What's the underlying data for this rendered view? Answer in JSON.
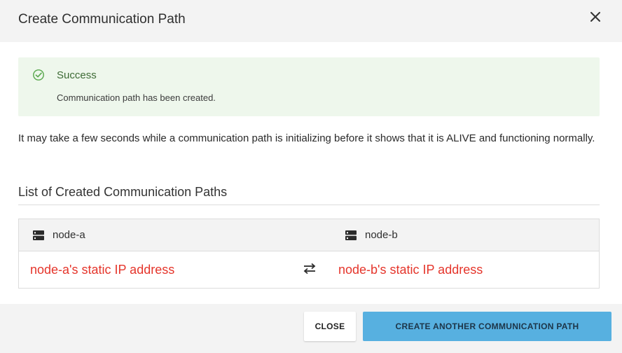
{
  "dialog": {
    "title": "Create Communication Path",
    "close_icon": "close-icon"
  },
  "alert": {
    "icon": "check-circle-icon",
    "title": "Success",
    "message": "Communication path has been created.",
    "color": "#3d6b35",
    "background": "#eef7ec"
  },
  "description": "It may take a few seconds while a communication path is initializing before it shows that it is ALIVE and functioning normally.",
  "section": {
    "title": "List of Created Communication Paths"
  },
  "table": {
    "columns": [
      {
        "icon": "server-icon",
        "label": "node-a"
      },
      {
        "icon": "server-icon",
        "label": "node-b"
      }
    ],
    "rows": [
      {
        "left": "node-a's static IP address",
        "connector_icon": "swap-arrows-icon",
        "right": "node-b's static IP address"
      }
    ],
    "annotation_color": "#e5352b"
  },
  "footer": {
    "close_label": "CLOSE",
    "create_label": "CREATE ANOTHER COMMUNICATION PATH",
    "primary_color": "#57b0e0"
  }
}
